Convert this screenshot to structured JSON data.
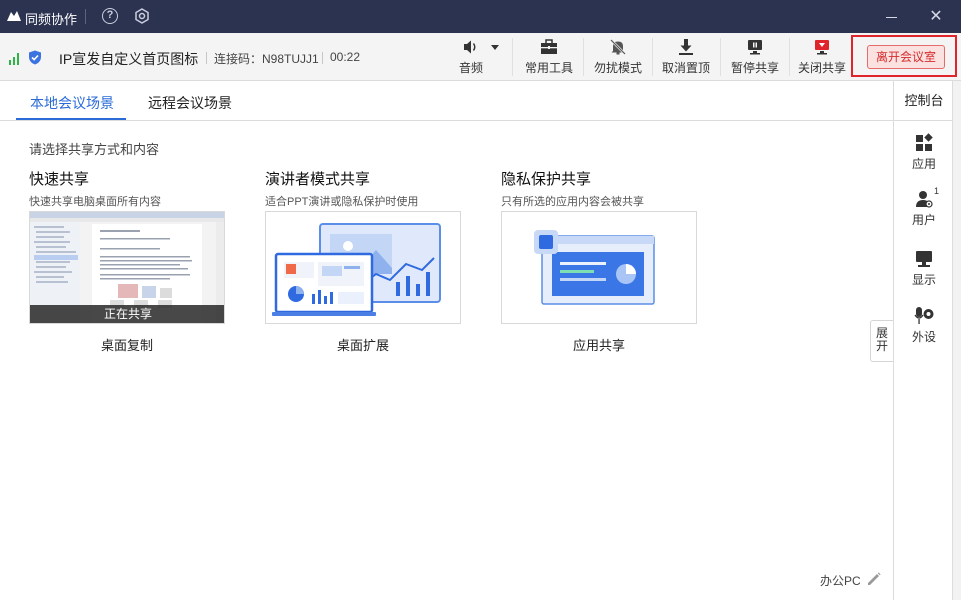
{
  "app": {
    "title": "同频协作"
  },
  "toolbar": {
    "meeting_title": "IP宣发自定义首页图标",
    "code_label": "连接码：N98TUJJ1",
    "duration": "00:22",
    "tools": [
      {
        "label": "音频",
        "icon": "speaker-icon"
      },
      {
        "label": "常用工具",
        "icon": "toolbox-icon"
      },
      {
        "label": "勿扰模式",
        "icon": "bell-off-icon"
      },
      {
        "label": "取消置顶",
        "icon": "unpin-icon"
      },
      {
        "label": "暂停共享",
        "icon": "pause-share-icon"
      },
      {
        "label": "关闭共享",
        "icon": "stop-share-icon"
      }
    ],
    "leave_button": "离开会议室",
    "colors": {
      "stop_share": "#e0242b",
      "leave_border": "#e0242b"
    }
  },
  "tabs": [
    {
      "label": "本地会议场景",
      "active": true
    },
    {
      "label": "远程会议场景",
      "active": false
    }
  ],
  "main": {
    "instruction": "请选择共享方式和内容",
    "cards": [
      {
        "title": "快速共享",
        "desc": "快速共享电脑桌面所有内容",
        "name": "桌面复制",
        "badge": "正在共享"
      },
      {
        "title": "演讲者模式共享",
        "desc": "适合PPT演讲或隐私保护时使用",
        "name": "桌面扩展"
      },
      {
        "title": "隐私保护共享",
        "desc": "只有所选的应用内容会被共享",
        "name": "应用共享"
      }
    ],
    "expand_label": "展开",
    "device_name": "办公PC"
  },
  "side": {
    "title": "控制台",
    "items": [
      {
        "label": "应用",
        "icon": "apps-grid-icon"
      },
      {
        "label": "用户",
        "icon": "user-icon",
        "count": "1"
      },
      {
        "label": "显示",
        "icon": "monitor-icon"
      },
      {
        "label": "外设",
        "icon": "mic-camera-icon"
      }
    ]
  },
  "accent": "#2a6bd8"
}
